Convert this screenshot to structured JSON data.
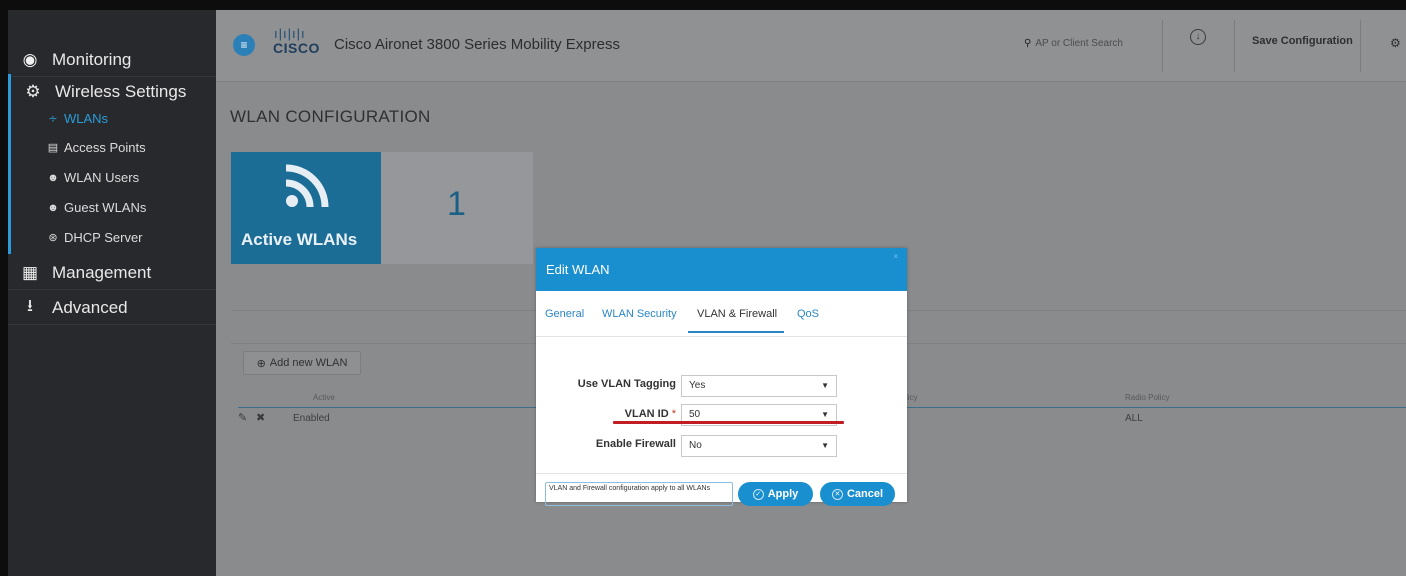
{
  "sidebar": {
    "monitoring": "Monitoring",
    "wireless_settings": "Wireless Settings",
    "items": [
      {
        "label": "WLANs"
      },
      {
        "label": "Access Points"
      },
      {
        "label": "WLAN Users"
      },
      {
        "label": "Guest WLANs"
      },
      {
        "label": "DHCP Server"
      }
    ],
    "management": "Management",
    "advanced": "Advanced"
  },
  "header": {
    "brand": "CISCO",
    "app_title": "Cisco Aironet 3800 Series Mobility Express",
    "search_placeholder": "AP or Client Search",
    "save_config": "Save Configuration"
  },
  "main": {
    "page_title": "WLAN CONFIGURATION",
    "tile_label": "Active WLANs",
    "active_count": "1",
    "add_button": "Add new WLAN",
    "table": {
      "columns": [
        "Active",
        "licy",
        "Radio Policy"
      ],
      "row": {
        "active": "Enabled",
        "radio_policy": "ALL"
      }
    }
  },
  "modal": {
    "title": "Edit WLAN",
    "close": "×",
    "tabs": [
      "General",
      "WLAN Security",
      "VLAN & Firewall",
      "QoS"
    ],
    "selected_tab": "VLAN & Firewall",
    "fields": {
      "vlan_tagging": {
        "label": "Use VLAN Tagging",
        "value": "Yes"
      },
      "vlan_id": {
        "label": "VLAN ID",
        "required_mark": "*",
        "value": "50"
      },
      "firewall": {
        "label": "Enable Firewall",
        "value": "No"
      }
    },
    "note": "VLAN and Firewall configuration apply to all WLANs",
    "apply": "Apply",
    "cancel": "Cancel"
  },
  "colors": {
    "accent": "#1a8fd0",
    "sidebar_bg": "#28292c",
    "tile_blue": "#1c6d96",
    "highlight_underline": "#c11e24"
  },
  "icons": [
    "dashboard-icon",
    "gear-icon",
    "wifi-icon",
    "access-point-icon",
    "users-icon",
    "dhcp-icon",
    "sitemap-icon",
    "download-icon",
    "search-icon",
    "menu-icon",
    "edit-icon",
    "delete-icon",
    "check-icon",
    "close-icon"
  ]
}
